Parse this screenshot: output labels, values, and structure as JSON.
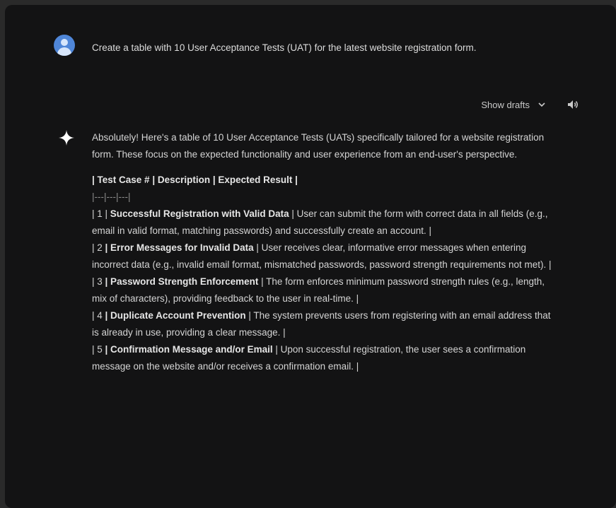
{
  "user": {
    "message": "Create a table with 10 User Acceptance Tests (UAT) for the latest website registration form."
  },
  "controls": {
    "show_drafts": "Show drafts"
  },
  "response": {
    "intro": "Absolutely! Here's a table of 10 User Acceptance Tests (UATs) specifically tailored for a website registration form. These focus on the expected functionality and user experience from an end-user's perspective.",
    "table_header": "| Test Case # | Description | Expected Result |",
    "separator": "|---|---|---|",
    "rows": [
      {
        "prefix": "| 1 | ",
        "title": "Successful Registration with Valid Data",
        "text": " | User can submit the form with correct data in all fields (e.g., email in valid format, matching passwords) and successfully create an account. |"
      },
      {
        "prefix": "| 2 ",
        "title": "| Error Messages for Invalid Data",
        "text": " | User receives clear, informative error messages when entering incorrect data (e.g., invalid email format, mismatched passwords, password strength requirements not met). |"
      },
      {
        "prefix": "| 3 ",
        "title": "| Password Strength Enforcement",
        "text": " | The form enforces minimum password strength rules (e.g., length, mix of characters), providing feedback to the user in real-time. |"
      },
      {
        "prefix": "| 4 ",
        "title": "| Duplicate Account Prevention",
        "text": " | The system prevents users from registering with an email address that is already in use, providing a clear message. |"
      },
      {
        "prefix": "| 5 ",
        "title": "| Confirmation Message and/or Email",
        "text": " | Upon successful registration, the user sees a confirmation message on the website and/or receives a confirmation email. |"
      }
    ]
  }
}
